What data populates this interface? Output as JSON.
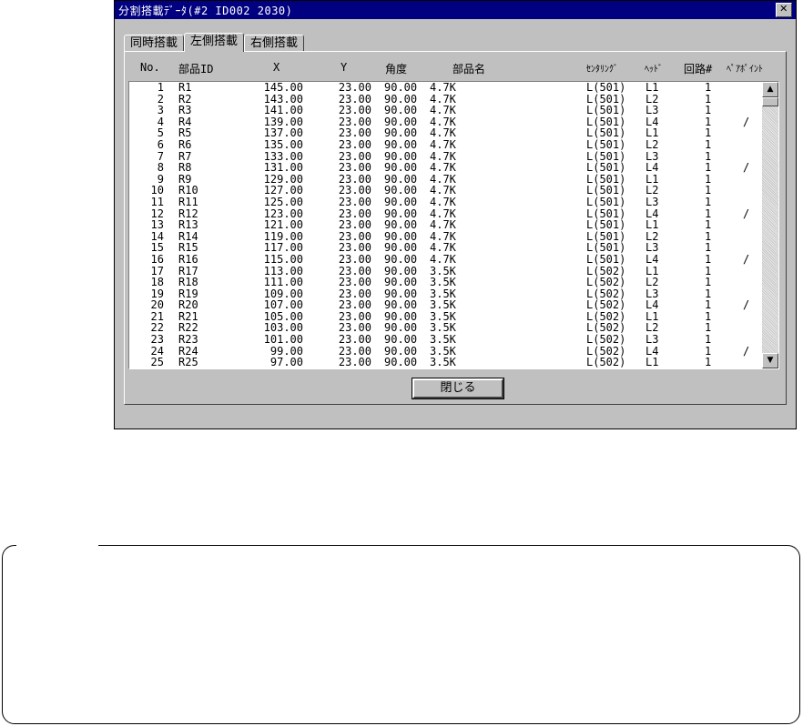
{
  "window": {
    "title": "分割搭載ﾃﾞｰﾀ(#2 ID002 2030)",
    "close_glyph": "✕"
  },
  "tabs": [
    {
      "label": "同時搭載"
    },
    {
      "label": "左側搭載"
    },
    {
      "label": "右側搭載"
    }
  ],
  "active_tab": "左側搭載",
  "columns": {
    "no": "No.",
    "part_id": "部品ID",
    "x": "X",
    "y": "Y",
    "angle": "角度",
    "part_name": "部品名",
    "centering": "ｾﾝﾀﾘﾝｸﾞ",
    "head": "ﾍｯﾄﾞ",
    "circuit": "回路#",
    "pair_point": "ﾍﾟｱﾎﾟｲﾝﾄ"
  },
  "rows": [
    {
      "no": "1",
      "id": "R1",
      "x": "145.00",
      "y": "23.00",
      "a": "90.00",
      "name": "4.7K",
      "c": "L(501)",
      "h": "L1",
      "cir": "1",
      "p": ""
    },
    {
      "no": "2",
      "id": "R2",
      "x": "143.00",
      "y": "23.00",
      "a": "90.00",
      "name": "4.7K",
      "c": "L(501)",
      "h": "L2",
      "cir": "1",
      "p": ""
    },
    {
      "no": "3",
      "id": "R3",
      "x": "141.00",
      "y": "23.00",
      "a": "90.00",
      "name": "4.7K",
      "c": "L(501)",
      "h": "L3",
      "cir": "1",
      "p": ""
    },
    {
      "no": "4",
      "id": "R4",
      "x": "139.00",
      "y": "23.00",
      "a": "90.00",
      "name": "4.7K",
      "c": "L(501)",
      "h": "L4",
      "cir": "1",
      "p": "/"
    },
    {
      "no": "5",
      "id": "R5",
      "x": "137.00",
      "y": "23.00",
      "a": "90.00",
      "name": "4.7K",
      "c": "L(501)",
      "h": "L1",
      "cir": "1",
      "p": ""
    },
    {
      "no": "6",
      "id": "R6",
      "x": "135.00",
      "y": "23.00",
      "a": "90.00",
      "name": "4.7K",
      "c": "L(501)",
      "h": "L2",
      "cir": "1",
      "p": ""
    },
    {
      "no": "7",
      "id": "R7",
      "x": "133.00",
      "y": "23.00",
      "a": "90.00",
      "name": "4.7K",
      "c": "L(501)",
      "h": "L3",
      "cir": "1",
      "p": ""
    },
    {
      "no": "8",
      "id": "R8",
      "x": "131.00",
      "y": "23.00",
      "a": "90.00",
      "name": "4.7K",
      "c": "L(501)",
      "h": "L4",
      "cir": "1",
      "p": "/"
    },
    {
      "no": "9",
      "id": "R9",
      "x": "129.00",
      "y": "23.00",
      "a": "90.00",
      "name": "4.7K",
      "c": "L(501)",
      "h": "L1",
      "cir": "1",
      "p": ""
    },
    {
      "no": "10",
      "id": "R10",
      "x": "127.00",
      "y": "23.00",
      "a": "90.00",
      "name": "4.7K",
      "c": "L(501)",
      "h": "L2",
      "cir": "1",
      "p": ""
    },
    {
      "no": "11",
      "id": "R11",
      "x": "125.00",
      "y": "23.00",
      "a": "90.00",
      "name": "4.7K",
      "c": "L(501)",
      "h": "L3",
      "cir": "1",
      "p": ""
    },
    {
      "no": "12",
      "id": "R12",
      "x": "123.00",
      "y": "23.00",
      "a": "90.00",
      "name": "4.7K",
      "c": "L(501)",
      "h": "L4",
      "cir": "1",
      "p": "/"
    },
    {
      "no": "13",
      "id": "R13",
      "x": "121.00",
      "y": "23.00",
      "a": "90.00",
      "name": "4.7K",
      "c": "L(501)",
      "h": "L1",
      "cir": "1",
      "p": ""
    },
    {
      "no": "14",
      "id": "R14",
      "x": "119.00",
      "y": "23.00",
      "a": "90.00",
      "name": "4.7K",
      "c": "L(501)",
      "h": "L2",
      "cir": "1",
      "p": ""
    },
    {
      "no": "15",
      "id": "R15",
      "x": "117.00",
      "y": "23.00",
      "a": "90.00",
      "name": "4.7K",
      "c": "L(501)",
      "h": "L3",
      "cir": "1",
      "p": ""
    },
    {
      "no": "16",
      "id": "R16",
      "x": "115.00",
      "y": "23.00",
      "a": "90.00",
      "name": "4.7K",
      "c": "L(501)",
      "h": "L4",
      "cir": "1",
      "p": "/"
    },
    {
      "no": "17",
      "id": "R17",
      "x": "113.00",
      "y": "23.00",
      "a": "90.00",
      "name": "3.5K",
      "c": "L(502)",
      "h": "L1",
      "cir": "1",
      "p": ""
    },
    {
      "no": "18",
      "id": "R18",
      "x": "111.00",
      "y": "23.00",
      "a": "90.00",
      "name": "3.5K",
      "c": "L(502)",
      "h": "L2",
      "cir": "1",
      "p": ""
    },
    {
      "no": "19",
      "id": "R19",
      "x": "109.00",
      "y": "23.00",
      "a": "90.00",
      "name": "3.5K",
      "c": "L(502)",
      "h": "L3",
      "cir": "1",
      "p": ""
    },
    {
      "no": "20",
      "id": "R20",
      "x": "107.00",
      "y": "23.00",
      "a": "90.00",
      "name": "3.5K",
      "c": "L(502)",
      "h": "L4",
      "cir": "1",
      "p": "/"
    },
    {
      "no": "21",
      "id": "R21",
      "x": "105.00",
      "y": "23.00",
      "a": "90.00",
      "name": "3.5K",
      "c": "L(502)",
      "h": "L1",
      "cir": "1",
      "p": ""
    },
    {
      "no": "22",
      "id": "R22",
      "x": "103.00",
      "y": "23.00",
      "a": "90.00",
      "name": "3.5K",
      "c": "L(502)",
      "h": "L2",
      "cir": "1",
      "p": ""
    },
    {
      "no": "23",
      "id": "R23",
      "x": "101.00",
      "y": "23.00",
      "a": "90.00",
      "name": "3.5K",
      "c": "L(502)",
      "h": "L3",
      "cir": "1",
      "p": ""
    },
    {
      "no": "24",
      "id": "R24",
      "x": "99.00",
      "y": "23.00",
      "a": "90.00",
      "name": "3.5K",
      "c": "L(502)",
      "h": "L4",
      "cir": "1",
      "p": "/"
    },
    {
      "no": "25",
      "id": "R25",
      "x": "97.00",
      "y": "23.00",
      "a": "90.00",
      "name": "3.5K",
      "c": "L(502)",
      "h": "L1",
      "cir": "1",
      "p": ""
    }
  ],
  "scrollbar": {
    "up_glyph": "▲",
    "down_glyph": "▼"
  },
  "buttons": {
    "close_label": "閉じる"
  },
  "colors": {
    "titlebar": "#000080",
    "face": "#c0c0c0"
  }
}
